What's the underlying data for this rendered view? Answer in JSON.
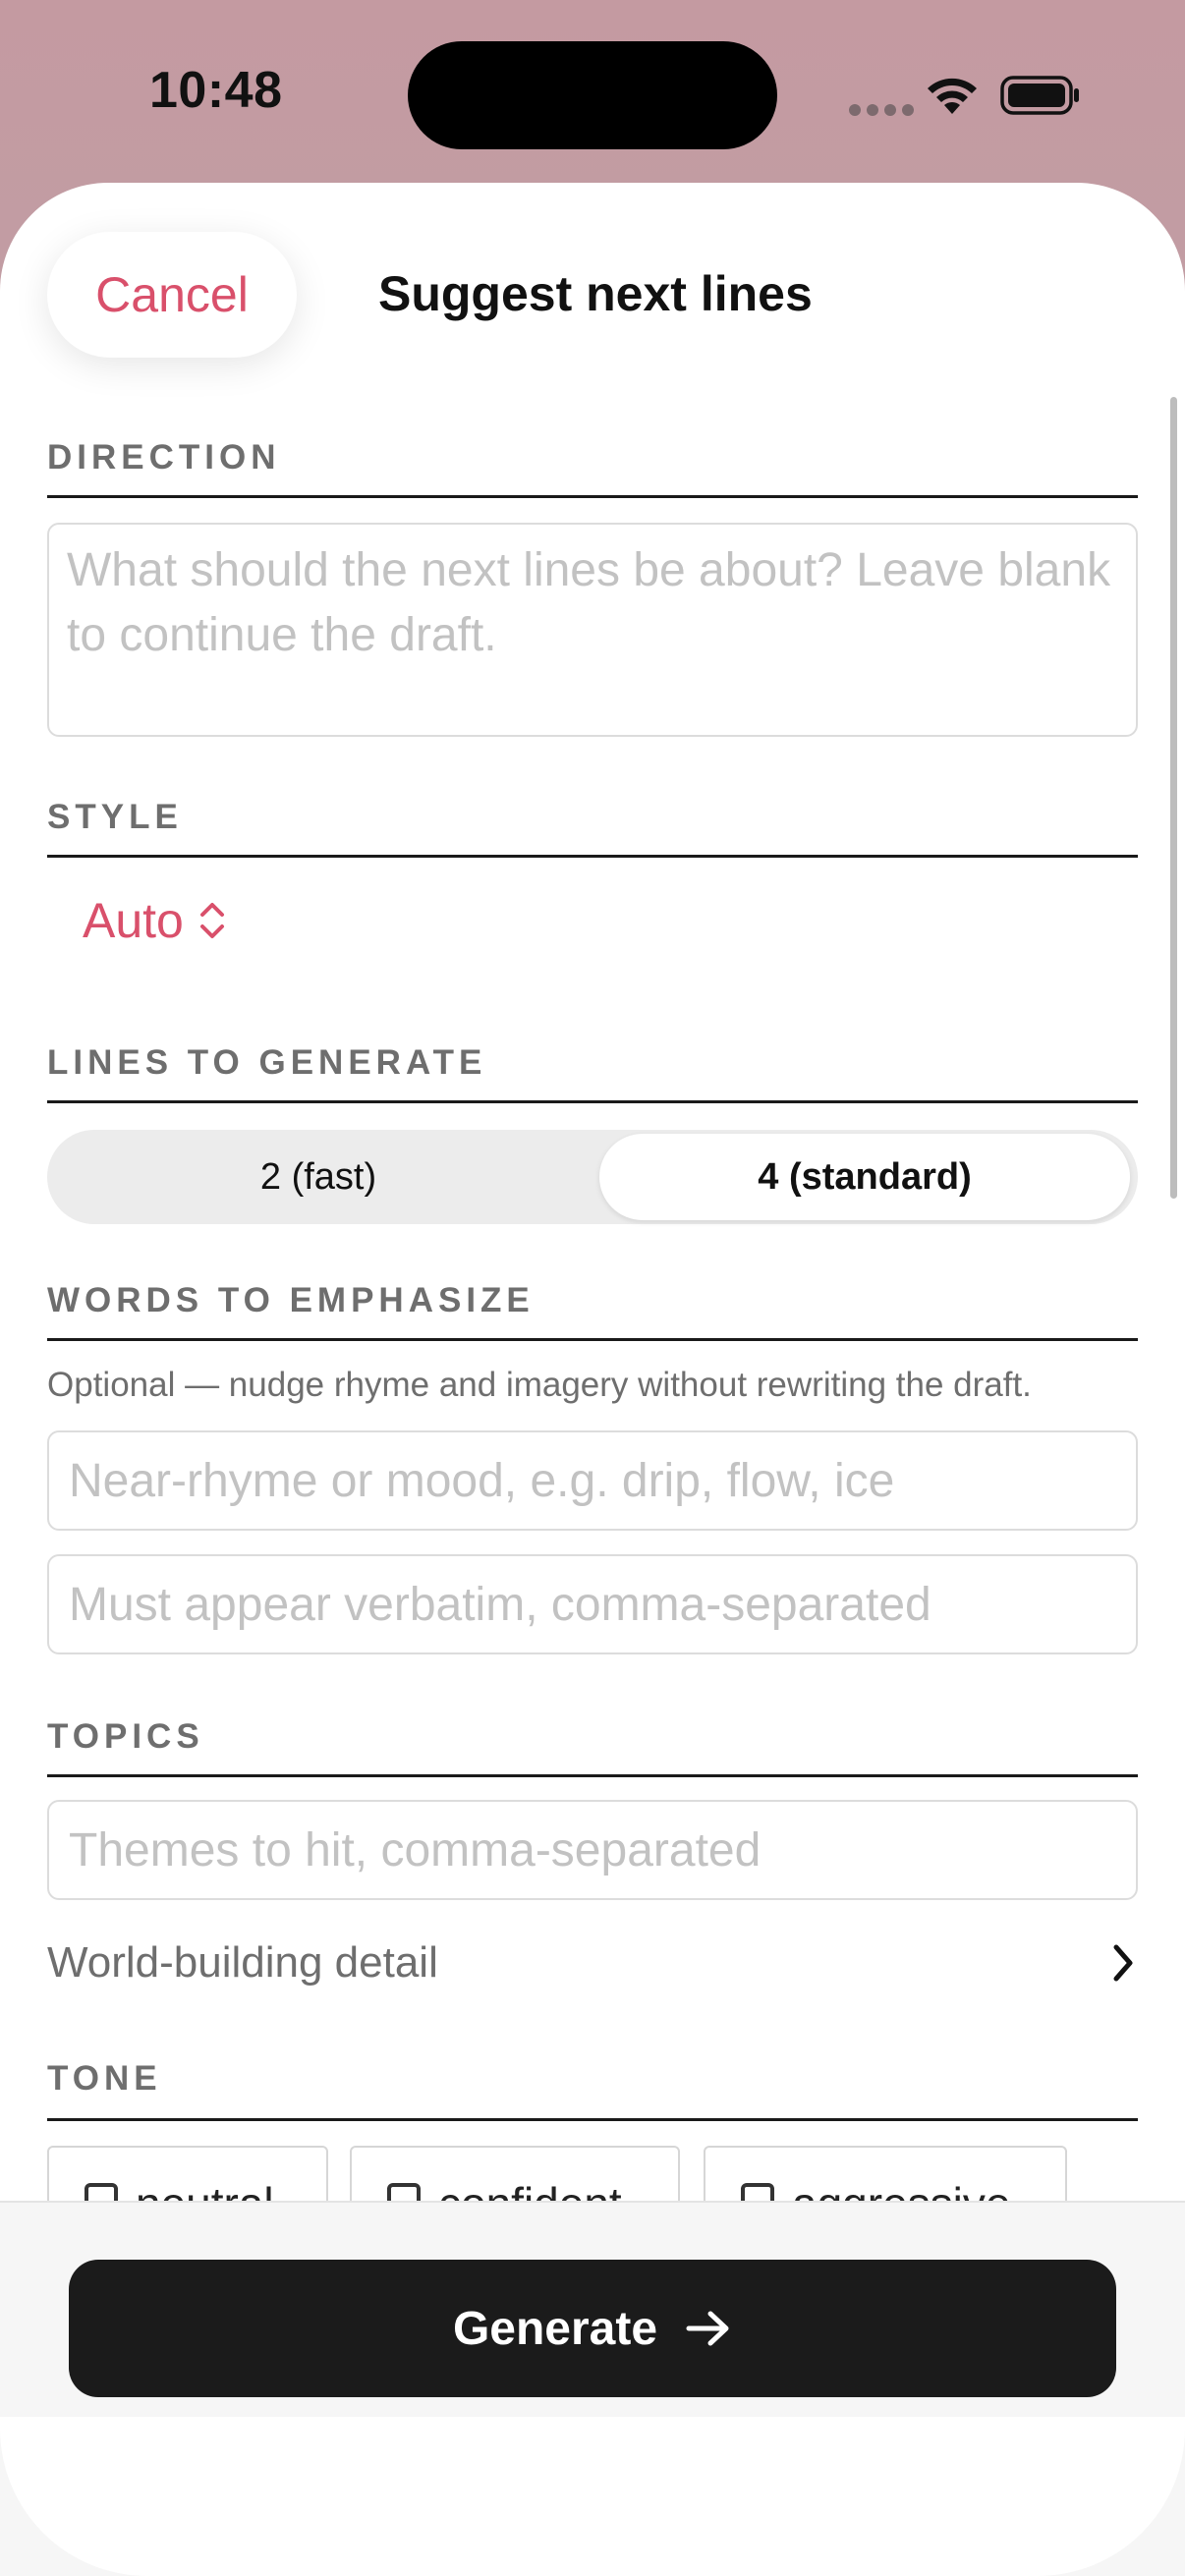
{
  "status_bar": {
    "time": "10:48"
  },
  "header": {
    "cancel_label": "Cancel",
    "title": "Suggest next lines"
  },
  "direction": {
    "label": "DIRECTION",
    "placeholder": "What should the next lines be about? Leave blank to continue the draft."
  },
  "style": {
    "label": "STYLE",
    "value": "Auto"
  },
  "lines": {
    "label": "LINES TO GENERATE",
    "options": [
      "2 (fast)",
      "4 (standard)"
    ],
    "selected": "4 (standard)"
  },
  "emphasize": {
    "label": "WORDS TO EMPHASIZE",
    "helper": "Optional — nudge rhyme and imagery without rewriting the draft.",
    "near_rhyme_placeholder": "Near-rhyme or mood, e.g. drip, flow, ice",
    "verbatim_placeholder": "Must appear verbatim, comma-separated"
  },
  "topics": {
    "label": "TOPICS",
    "placeholder": "Themes to hit, comma-separated",
    "world_building_label": "World-building detail"
  },
  "tone": {
    "label": "TONE",
    "options": [
      "neutral",
      "confident",
      "aggressive"
    ]
  },
  "footer": {
    "generate_label": "Generate"
  },
  "colors": {
    "accent": "#d9506b",
    "button_dark": "#1b1b1b"
  }
}
